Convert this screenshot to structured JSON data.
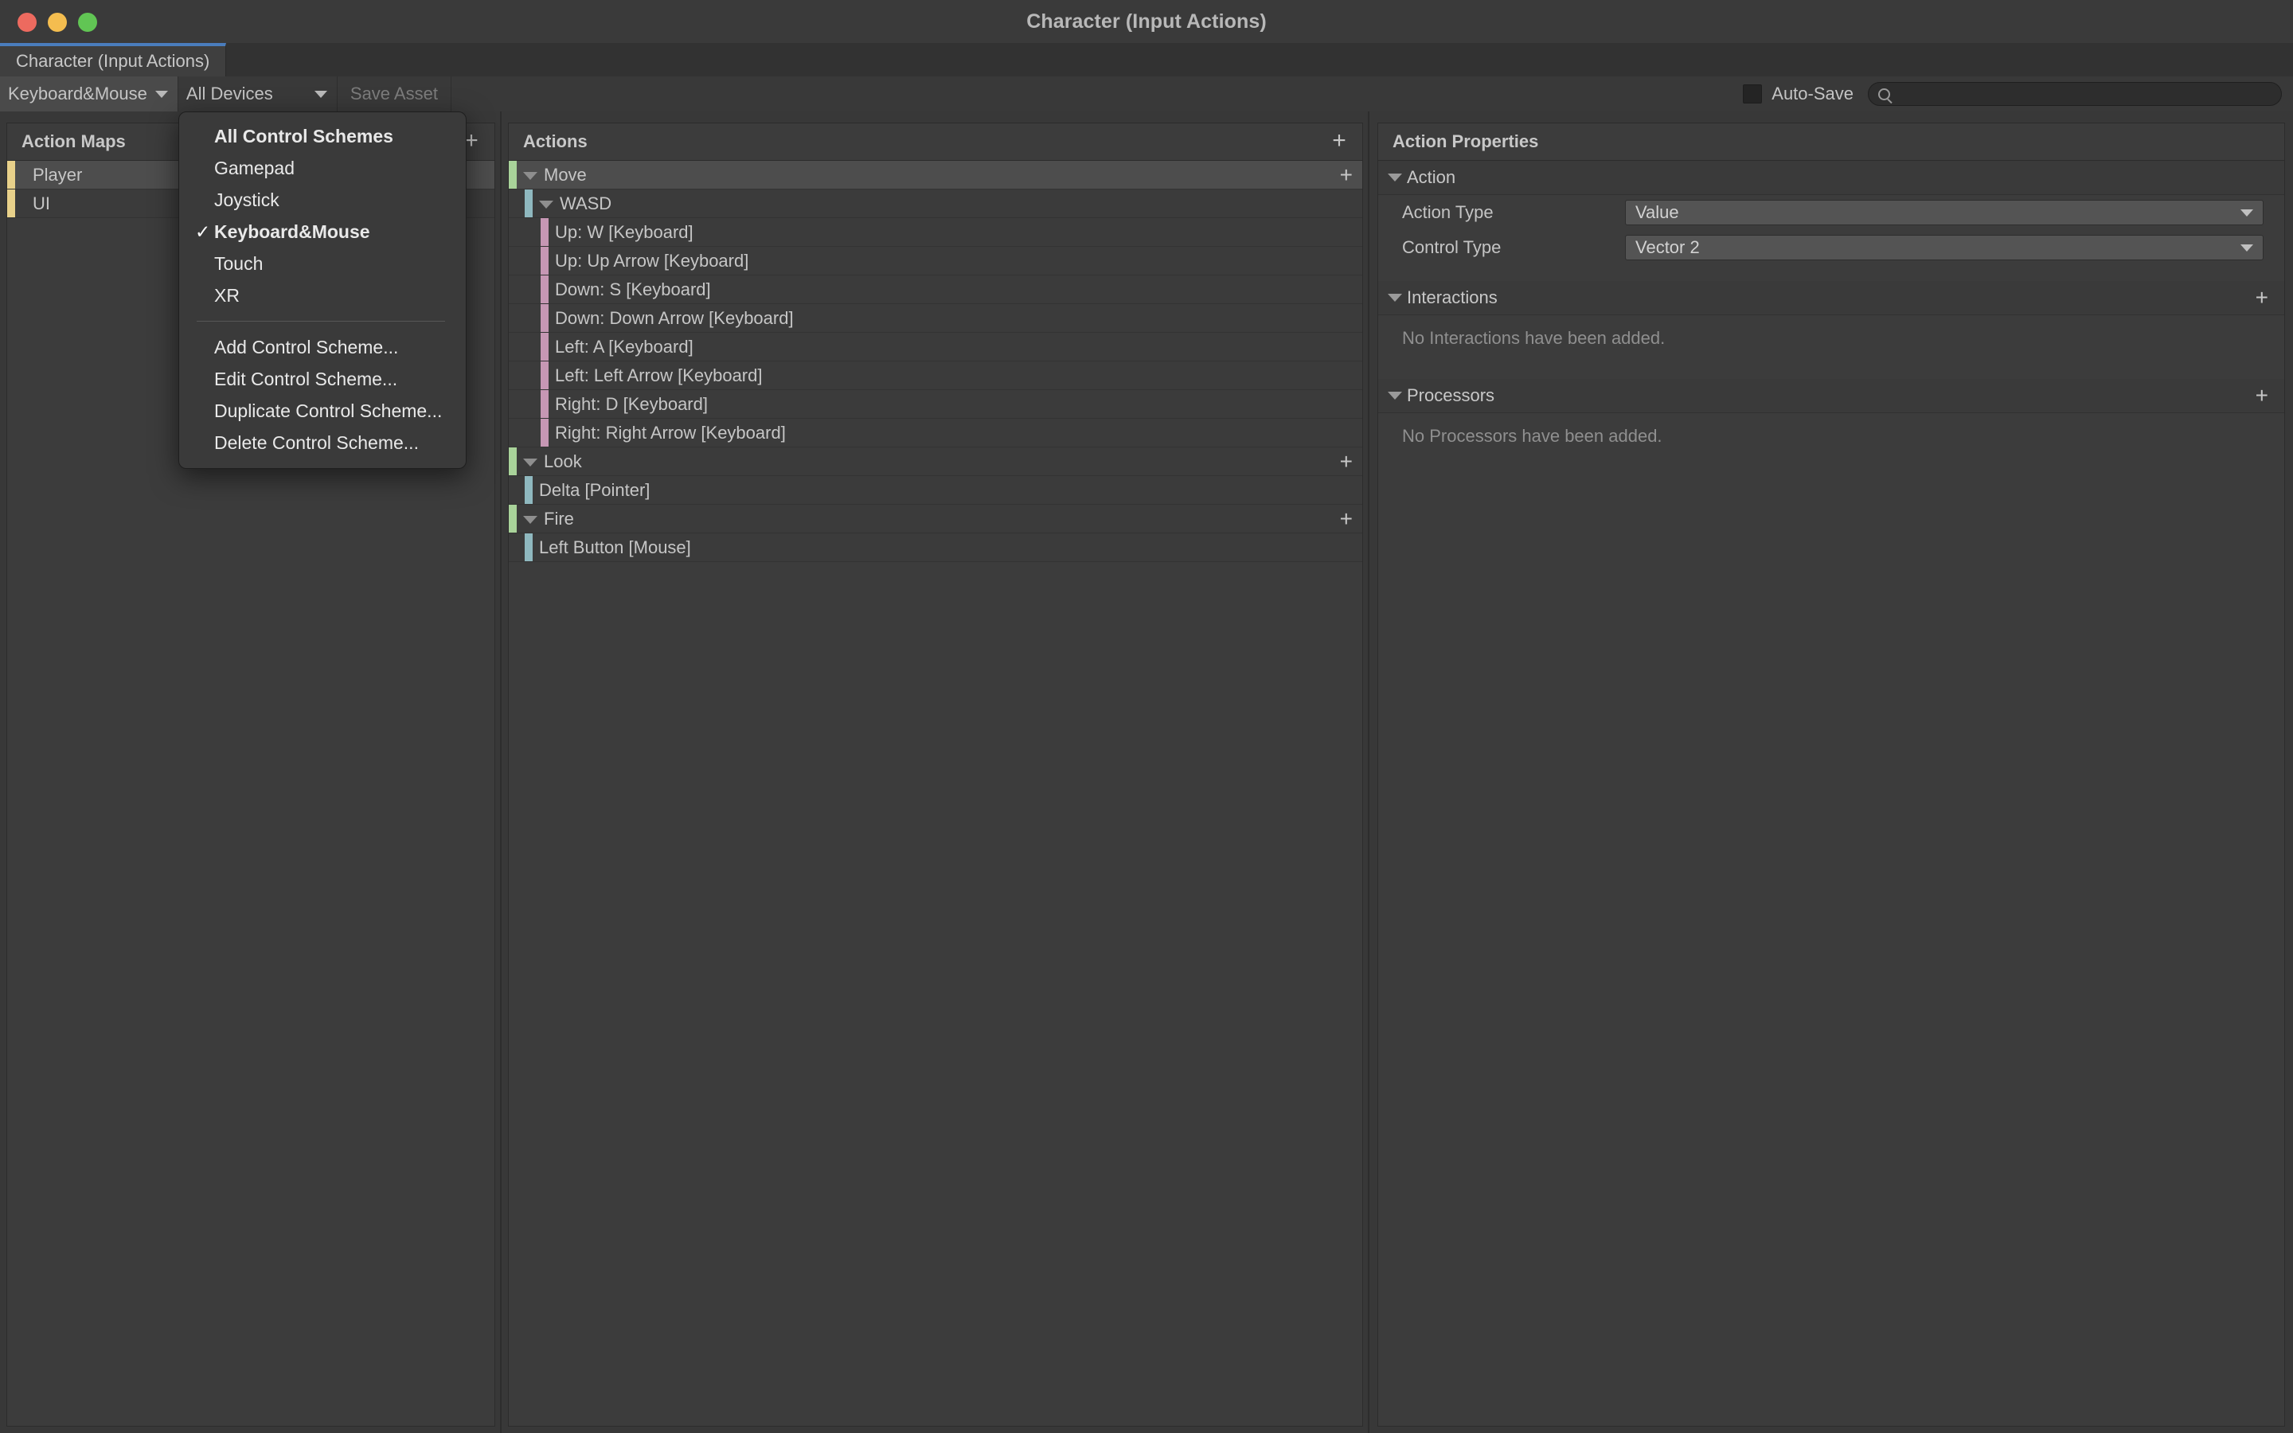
{
  "window": {
    "title": "Character (Input Actions)",
    "traffic_lights": [
      "close-button",
      "minimize-button",
      "zoom-button"
    ],
    "overflow_menu_icon": "kebab-menu-icon"
  },
  "tab": {
    "label": "Character (Input Actions)"
  },
  "toolbar": {
    "control_scheme": "Keyboard&Mouse",
    "device_filter": "All Devices",
    "save_asset_label": "Save Asset",
    "autosave_label": "Auto-Save",
    "autosave_checked": false,
    "search_value": "",
    "search_placeholder": "",
    "search_icon": "search-icon"
  },
  "control_scheme_menu": {
    "items": [
      {
        "label": "All Control Schemes",
        "checked": false,
        "bold": true
      },
      {
        "label": "Gamepad",
        "checked": false,
        "bold": false
      },
      {
        "label": "Joystick",
        "checked": false,
        "bold": false
      },
      {
        "label": "Keyboard&Mouse",
        "checked": true,
        "bold": true
      },
      {
        "label": "Touch",
        "checked": false,
        "bold": false
      },
      {
        "label": "XR",
        "checked": false,
        "bold": false
      }
    ],
    "separator_after_index": 5,
    "commands": [
      {
        "label": "Add Control Scheme..."
      },
      {
        "label": "Edit Control Scheme..."
      },
      {
        "label": "Duplicate Control Scheme..."
      },
      {
        "label": "Delete Control Scheme..."
      }
    ],
    "check_glyph": "✓"
  },
  "action_maps": {
    "header": "Action Maps",
    "add_icon": "plus-icon",
    "items": [
      {
        "label": "Player",
        "selected": true,
        "color": "#e8d18a"
      },
      {
        "label": "UI",
        "selected": false,
        "color": "#e8d18a"
      }
    ]
  },
  "actions": {
    "header": "Actions",
    "add_icon": "plus-icon",
    "rows": [
      {
        "label": "Move",
        "indent": 0,
        "expandable": true,
        "selected": true,
        "color": "#a9d39a",
        "has_add": true
      },
      {
        "label": "WASD",
        "indent": 1,
        "expandable": true,
        "selected": false,
        "color": "#8fb8bf",
        "has_add": false
      },
      {
        "label": "Up: W [Keyboard]",
        "indent": 2,
        "expandable": false,
        "selected": false,
        "color": "#c697b4",
        "has_add": false
      },
      {
        "label": "Up: Up Arrow [Keyboard]",
        "indent": 2,
        "expandable": false,
        "selected": false,
        "color": "#c697b4",
        "has_add": false
      },
      {
        "label": "Down: S [Keyboard]",
        "indent": 2,
        "expandable": false,
        "selected": false,
        "color": "#c697b4",
        "has_add": false
      },
      {
        "label": "Down: Down Arrow [Keyboard]",
        "indent": 2,
        "expandable": false,
        "selected": false,
        "color": "#c697b4",
        "has_add": false
      },
      {
        "label": "Left: A [Keyboard]",
        "indent": 2,
        "expandable": false,
        "selected": false,
        "color": "#c697b4",
        "has_add": false
      },
      {
        "label": "Left: Left Arrow [Keyboard]",
        "indent": 2,
        "expandable": false,
        "selected": false,
        "color": "#c697b4",
        "has_add": false
      },
      {
        "label": "Right: D [Keyboard]",
        "indent": 2,
        "expandable": false,
        "selected": false,
        "color": "#c697b4",
        "has_add": false
      },
      {
        "label": "Right: Right Arrow [Keyboard]",
        "indent": 2,
        "expandable": false,
        "selected": false,
        "color": "#c697b4",
        "has_add": false
      },
      {
        "label": "Look",
        "indent": 0,
        "expandable": true,
        "selected": false,
        "color": "#a9d39a",
        "has_add": true
      },
      {
        "label": "Delta [Pointer]",
        "indent": 1,
        "expandable": false,
        "selected": false,
        "color": "#8fb8bf",
        "has_add": false
      },
      {
        "label": "Fire",
        "indent": 0,
        "expandable": true,
        "selected": false,
        "color": "#a9d39a",
        "has_add": true
      },
      {
        "label": "Left Button [Mouse]",
        "indent": 1,
        "expandable": false,
        "selected": false,
        "color": "#8fb8bf",
        "has_add": false
      }
    ]
  },
  "properties": {
    "header": "Action Properties",
    "action_section": {
      "title": "Action",
      "fields": [
        {
          "label": "Action Type",
          "value": "Value"
        },
        {
          "label": "Control Type",
          "value": "Vector 2"
        }
      ]
    },
    "interactions_section": {
      "title": "Interactions",
      "empty_text": "No Interactions have been added.",
      "add_icon": "plus-icon"
    },
    "processors_section": {
      "title": "Processors",
      "empty_text": "No Processors have been added.",
      "add_icon": "plus-icon"
    }
  }
}
